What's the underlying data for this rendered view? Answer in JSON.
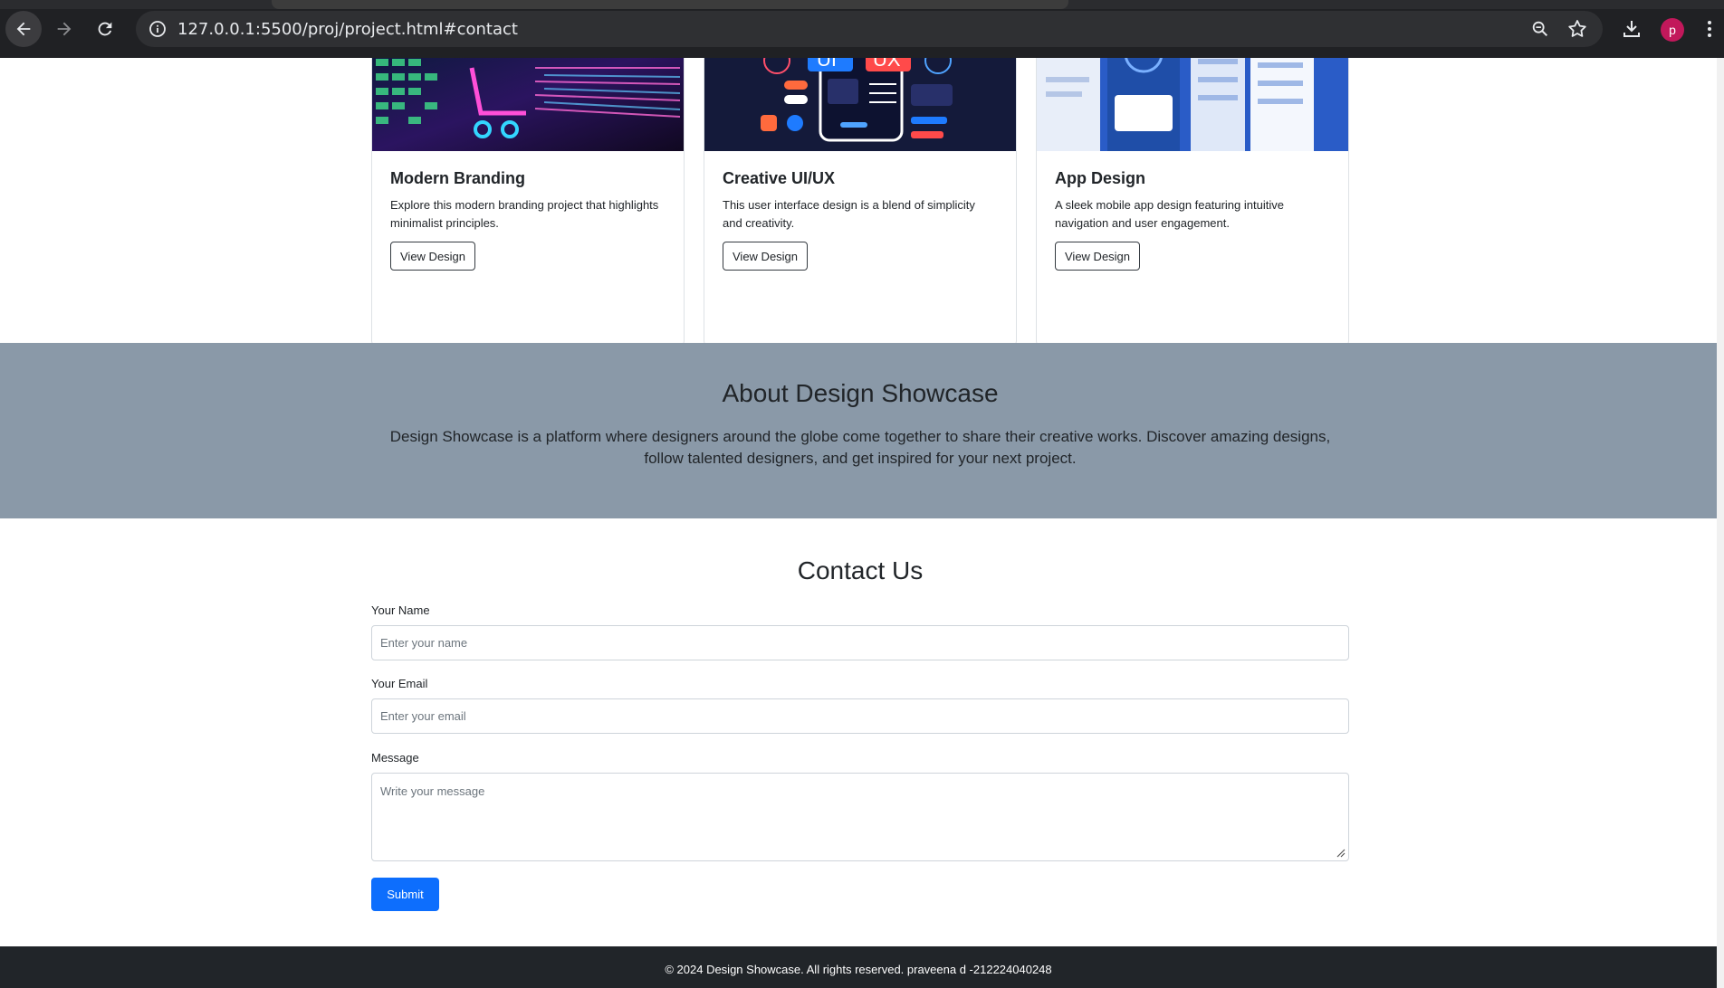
{
  "browser": {
    "url": "127.0.0.1:5500/proj/project.html#contact",
    "avatar_letter": "p"
  },
  "cards": [
    {
      "title": "Modern Branding",
      "text": "Explore this modern branding project that highlights minimalist principles.",
      "button": "View Design"
    },
    {
      "title": "Creative UI/UX",
      "text": "This user interface design is a blend of simplicity and creativity.",
      "button": "View Design",
      "thumb_badges": [
        "UI",
        "UX"
      ]
    },
    {
      "title": "App Design",
      "text": "A sleek mobile app design featuring intuitive navigation and user engagement.",
      "button": "View Design"
    }
  ],
  "about": {
    "title": "About Design Showcase",
    "text": "Design Showcase is a platform where designers around the globe come together to share their creative works. Discover amazing designs, follow talented designers, and get inspired for your next project."
  },
  "contact": {
    "title": "Contact Us",
    "name_label": "Your Name",
    "name_placeholder": "Enter your name",
    "email_label": "Your Email",
    "email_placeholder": "Enter your email",
    "message_label": "Message",
    "message_placeholder": "Write your message",
    "submit": "Submit"
  },
  "footer": {
    "text": "© 2024 Design Showcase. All rights reserved. praveena d -212224040248"
  },
  "colors": {
    "about_bg": "#8a99a8",
    "primary": "#0d6efd",
    "footer_bg": "#212529"
  }
}
